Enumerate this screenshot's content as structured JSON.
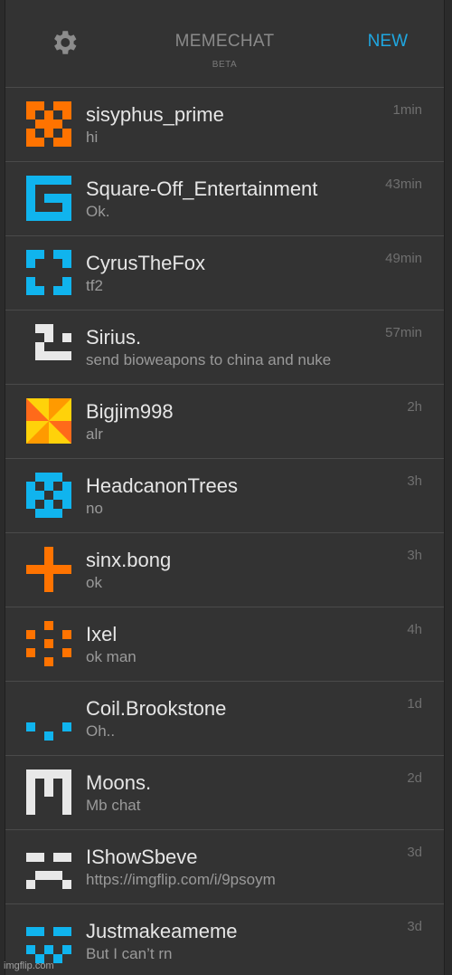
{
  "header": {
    "settings_icon": "gear-icon",
    "title": "MEMECHAT",
    "subtitle": "BETA",
    "new_label": "NEW"
  },
  "colors": {
    "accent": "#1fa7e1",
    "orange": "#ff7300",
    "blue": "#10b4ee",
    "white": "#e8e8e8",
    "background": "#333333"
  },
  "chats": [
    {
      "name": "sisyphus_prime",
      "message": "hi",
      "time": "1min",
      "avatar": "orange-pixel-avatar"
    },
    {
      "name": "Square-Off_Entertainment",
      "message": "Ok.",
      "time": "43min",
      "avatar": "blue-pixel-avatar"
    },
    {
      "name": "CyrusTheFox",
      "message": "tf2",
      "time": "49min",
      "avatar": "blue-pixel-avatar"
    },
    {
      "name": "Sirius.",
      "message": "send bioweapons to china and nuke",
      "time": "57min",
      "avatar": "white-pixel-avatar"
    },
    {
      "name": "Bigjim998",
      "message": "alr",
      "time": "2h",
      "avatar": "pinwheel-avatar"
    },
    {
      "name": "HeadcanonTrees",
      "message": "no",
      "time": "3h",
      "avatar": "blue-pixel-avatar"
    },
    {
      "name": "sinx.bong",
      "message": "ok",
      "time": "3h",
      "avatar": "orange-pixel-avatar"
    },
    {
      "name": "Ixel",
      "message": "ok man",
      "time": "4h",
      "avatar": "orange-pixel-avatar"
    },
    {
      "name": "Coil.Brookstone",
      "message": "Oh..",
      "time": "1d",
      "avatar": "blue-pixel-avatar"
    },
    {
      "name": "Moons.",
      "message": "Mb chat",
      "time": "2d",
      "avatar": "white-pixel-avatar"
    },
    {
      "name": "IShowSbeve",
      "message": "https://imgflip.com/i/9psoym",
      "time": "3d",
      "avatar": "white-pixel-avatar"
    },
    {
      "name": "Justmakeameme",
      "message": "But I can’t rn",
      "time": "3d",
      "avatar": "blue-pixel-avatar"
    }
  ],
  "watermark": "imgflip.com"
}
